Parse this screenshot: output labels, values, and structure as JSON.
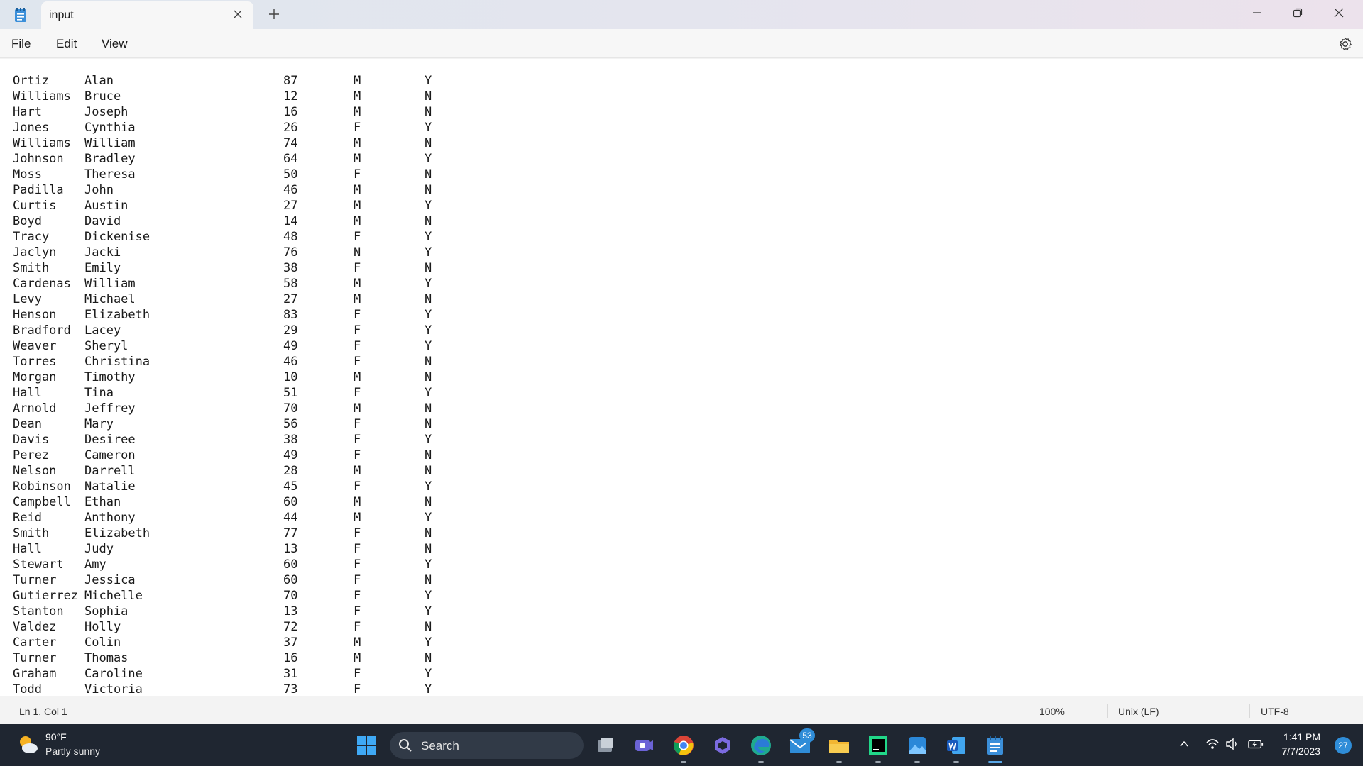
{
  "window": {
    "tab_title": "input"
  },
  "menu": {
    "file": "File",
    "edit": "Edit",
    "view": "View"
  },
  "rows": [
    [
      "Ortiz",
      "Alan",
      "87",
      "M",
      "Y"
    ],
    [
      "Williams",
      "Bruce",
      "12",
      "M",
      "N"
    ],
    [
      "Hart",
      "Joseph",
      "16",
      "M",
      "N"
    ],
    [
      "Jones",
      "Cynthia",
      "26",
      "F",
      "Y"
    ],
    [
      "Williams",
      "William",
      "74",
      "M",
      "N"
    ],
    [
      "Johnson",
      "Bradley",
      "64",
      "M",
      "Y"
    ],
    [
      "Moss",
      "Theresa",
      "50",
      "F",
      "N"
    ],
    [
      "Padilla",
      "John",
      "46",
      "M",
      "N"
    ],
    [
      "Curtis",
      "Austin",
      "27",
      "M",
      "Y"
    ],
    [
      "Boyd",
      "David",
      "14",
      "M",
      "N"
    ],
    [
      "Tracy",
      "Dickenise",
      "48",
      "F",
      "Y"
    ],
    [
      "Jaclyn",
      "Jacki",
      "76",
      "N",
      "Y"
    ],
    [
      "Smith",
      "Emily",
      "38",
      "F",
      "N"
    ],
    [
      "Cardenas",
      "William",
      "58",
      "M",
      "Y"
    ],
    [
      "Levy",
      "Michael",
      "27",
      "M",
      "N"
    ],
    [
      "Henson",
      "Elizabeth",
      "83",
      "F",
      "Y"
    ],
    [
      "Bradford",
      "Lacey",
      "29",
      "F",
      "Y"
    ],
    [
      "Weaver",
      "Sheryl",
      "49",
      "F",
      "Y"
    ],
    [
      "Torres",
      "Christina",
      "46",
      "F",
      "N"
    ],
    [
      "Morgan",
      "Timothy",
      "10",
      "M",
      "N"
    ],
    [
      "Hall",
      "Tina",
      "51",
      "F",
      "Y"
    ],
    [
      "Arnold",
      "Jeffrey",
      "70",
      "M",
      "N"
    ],
    [
      "Dean",
      "Mary",
      "56",
      "F",
      "N"
    ],
    [
      "Davis",
      "Desiree",
      "38",
      "F",
      "Y"
    ],
    [
      "Perez",
      "Cameron",
      "49",
      "F",
      "N"
    ],
    [
      "Nelson",
      "Darrell",
      "28",
      "M",
      "N"
    ],
    [
      "Robinson",
      "Natalie",
      "45",
      "F",
      "Y"
    ],
    [
      "Campbell",
      "Ethan",
      "60",
      "M",
      "N"
    ],
    [
      "Reid",
      "Anthony",
      "44",
      "M",
      "Y"
    ],
    [
      "Smith",
      "Elizabeth",
      "77",
      "F",
      "N"
    ],
    [
      "Hall",
      "Judy",
      "13",
      "F",
      "N"
    ],
    [
      "Stewart",
      "Amy",
      "60",
      "F",
      "Y"
    ],
    [
      "Turner",
      "Jessica",
      "60",
      "F",
      "N"
    ],
    [
      "Gutierrez",
      "Michelle",
      "70",
      "F",
      "Y"
    ],
    [
      "Stanton",
      "Sophia",
      "13",
      "F",
      "Y"
    ],
    [
      "Valdez",
      "Holly",
      "72",
      "F",
      "N"
    ],
    [
      "Carter",
      "Colin",
      "37",
      "M",
      "Y"
    ],
    [
      "Turner",
      "Thomas",
      "16",
      "M",
      "N"
    ],
    [
      "Graham",
      "Caroline",
      "31",
      "F",
      "Y"
    ],
    [
      "Todd",
      "Victoria",
      "73",
      "F",
      "Y"
    ]
  ],
  "status": {
    "position": "Ln 1, Col 1",
    "zoom": "100%",
    "line_ending": "Unix (LF)",
    "encoding": "UTF-8"
  },
  "taskbar": {
    "weather_temp": "90°F",
    "weather_desc": "Partly sunny",
    "search_label": "Search",
    "mail_badge": "53",
    "time": "1:41 PM",
    "date": "7/7/2023",
    "notifications": "27"
  },
  "colors": {
    "accent": "#2f8dd8",
    "taskbar_bg": "#1f2631"
  }
}
